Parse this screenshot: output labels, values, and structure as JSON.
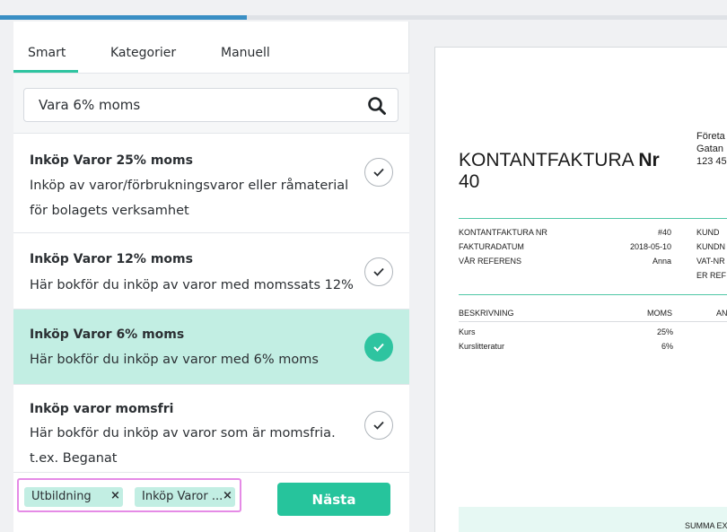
{
  "progress": {
    "percent": 34
  },
  "tabs": [
    {
      "label": "Smart",
      "active": true
    },
    {
      "label": "Kategorier",
      "active": false
    },
    {
      "label": "Manuell",
      "active": false
    }
  ],
  "search": {
    "value": "Vara 6% moms",
    "icon": "search-icon"
  },
  "items": [
    {
      "title": "Inköp Varor 25% moms",
      "desc": "Inköp av varor/förbrukningsvaror eller råmaterial för bolagets verksamhet",
      "selected": false
    },
    {
      "title": "Inköp Varor 12% moms",
      "desc": "Här bokför du inköp av varor med momssats 12%",
      "selected": false
    },
    {
      "title": "Inköp Varor 6% moms",
      "desc": "Här bokför du inköp av varor med 6% moms",
      "selected": true
    },
    {
      "title": "Inköp varor momsfri",
      "desc": "Här bokför du inköp av varor som är momsfria. t.ex. Beganat",
      "selected": false
    }
  ],
  "chips": [
    {
      "label": "Utbildning",
      "remove": "×"
    },
    {
      "label": "Inköp Varor ...",
      "remove": "×"
    }
  ],
  "next_button": "Nästa",
  "invoice": {
    "title_prefix": "KONTANTFAKTURA",
    "title_nr": "Nr",
    "number": "40",
    "company_lines": [
      "Företa",
      "Gatan",
      "123 45"
    ],
    "left_meta": [
      {
        "label": "KONTANTFAKTURA NR",
        "value": "#40"
      },
      {
        "label": "FAKTURADATUM",
        "value": "2018-05-10"
      },
      {
        "label": "VÅR REFERENS",
        "value": "Anna"
      }
    ],
    "right_meta": [
      "KUND",
      "KUNDN",
      "VAT-NR",
      "ER REF"
    ],
    "columns": {
      "description": "BESKRIVNING",
      "vat": "MOMS",
      "amount": "AN"
    },
    "rows": [
      {
        "description": "Kurs",
        "vat": "25%"
      },
      {
        "description": "Kurslitteratur",
        "vat": "6%"
      }
    ],
    "summa": "SUMMA EX"
  },
  "colors": {
    "accent": "#2ec4a0",
    "selected_bg": "#c2eee3",
    "progress": "#3a8fc4",
    "highlight_frame": "#e58be6"
  }
}
